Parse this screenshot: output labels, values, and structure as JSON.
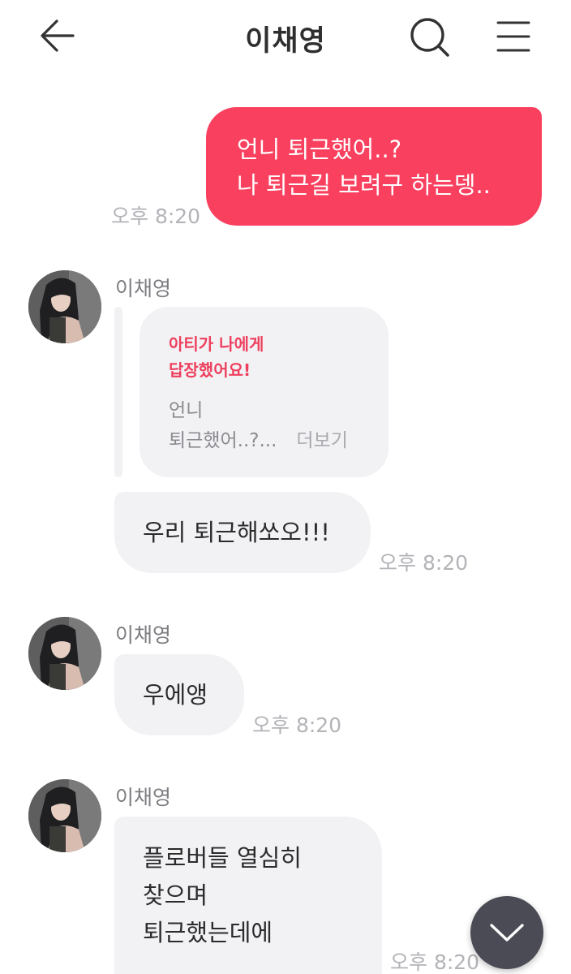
{
  "header": {
    "title": "이채영",
    "back_icon": "arrow-left-icon",
    "search_icon": "search-icon",
    "menu_icon": "hamburger-menu-icon"
  },
  "colors": {
    "accent": "#f9405f",
    "bubble_received": "#f2f2f5",
    "fab": "#4a4b54"
  },
  "messages": {
    "sent": {
      "lines": [
        "언니 퇴근했어..?",
        "나 퇴근길 보려구 하는뎅.."
      ],
      "time": "오후 8:20"
    },
    "group1": {
      "sender": "이채영",
      "reply_notice": [
        "아티가 나에게",
        "답장했어요!"
      ],
      "quote_lines": [
        "언니",
        "퇴근했어..?..."
      ],
      "more_label": "더보기",
      "bubble": "우리 퇴근해쏘오!!!",
      "time": "오후 8:20"
    },
    "group2": {
      "sender": "이채영",
      "bubble": "우에앵",
      "time": "오후 8:20"
    },
    "group3": {
      "sender": "이채영",
      "lines": [
        "플로버들 열심히",
        "찾으며",
        "퇴근했는데에"
      ],
      "time": "오후 8:20"
    }
  },
  "fab_icon": "chevron-down-icon"
}
